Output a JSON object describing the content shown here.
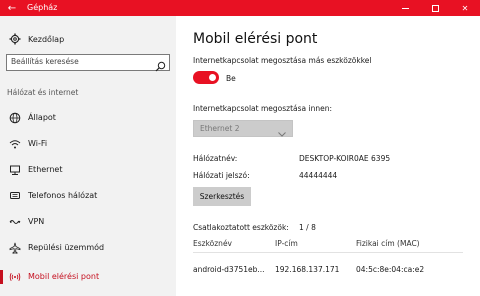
{
  "window": {
    "title": "Gépház",
    "back": "←",
    "minimize": "—",
    "maximize": "□",
    "close": "✕"
  },
  "sidebar": {
    "home_label": "Kezdőlap",
    "search_placeholder": "Beállítás keresése",
    "section_title": "Hálózat és internet",
    "items": [
      {
        "label": "Állapot",
        "icon": "globe-icon"
      },
      {
        "label": "Wi-Fi",
        "icon": "wifi-icon"
      },
      {
        "label": "Ethernet",
        "icon": "ethernet-icon"
      },
      {
        "label": "Telefonos hálózat",
        "icon": "phone-icon"
      },
      {
        "label": "VPN",
        "icon": "vpn-icon"
      },
      {
        "label": "Repülési üzemmód",
        "icon": "airplane-icon"
      },
      {
        "label": "Mobil elérési pont",
        "icon": "hotspot-icon",
        "active": true
      }
    ]
  },
  "main": {
    "title": "Mobil elérési pont",
    "share_label": "Internetkapcsolat megosztása más eszközökkel",
    "toggle_state": "Be",
    "share_from_label": "Internetkapcsolat megosztása innen:",
    "share_from_value": "Ethernet 2",
    "network_name_label": "Hálózatnév:",
    "network_name_value": "DESKTOP-KOIR0AE 6395",
    "password_label": "Hálózati jelszó:",
    "password_value": "44444444",
    "edit_button": "Szerkesztés",
    "connected_label": "Csatlakoztatott eszközök:",
    "connected_value": "1 / 8",
    "table": {
      "headers": [
        "Eszköznév",
        "IP-cím",
        "Fizikai cím (MAC)"
      ],
      "rows": [
        [
          "android-d3751eb...",
          "192.168.137.171",
          "04:5c:8e:04:ca:e2"
        ]
      ]
    }
  },
  "colors": {
    "accent": "#e81123",
    "active_text": "#c50f1f",
    "sidebar_bg": "#f2f2f2"
  }
}
